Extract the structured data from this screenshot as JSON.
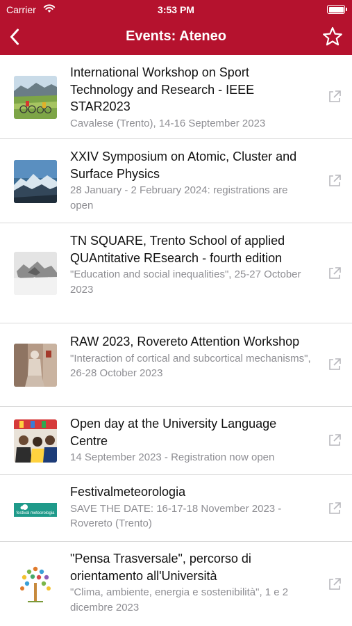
{
  "status": {
    "carrier": "Carrier",
    "time": "3:53 PM"
  },
  "nav": {
    "title": "Events: Ateneo",
    "back_icon": "chevron-left-icon",
    "favorite_icon": "star-icon"
  },
  "colors": {
    "brand": "#b5122e",
    "subtitle": "#8e8e93",
    "separator": "#d9d9d9",
    "external_icon": "#b8b8bd"
  },
  "events": [
    {
      "title": "International Workshop on Sport Technology and Research - IEEE STAR2023",
      "subtitle": "Cavalese (Trento), 14-16 September 2023",
      "image": "cyclists-in-mountains"
    },
    {
      "title": "XXIV Symposium on Atomic, Cluster and Surface Physics",
      "subtitle": "28 January - 2 February 2024: registrations are open",
      "image": "snowy-mountains"
    },
    {
      "title": "TN SQUARE, Trento School of applied QUAntitative REsearch - fourth edition",
      "subtitle": "\"Education and social inequalities\", 25-27 October 2023",
      "image": "misty-peaks"
    },
    {
      "title": "RAW 2023, Rovereto Attention Workshop",
      "subtitle": "\"Interaction of cortical and subcortical mechanisms\", 26-28 October 2023",
      "image": "statue"
    },
    {
      "title": "Open day at the University Language Centre",
      "subtitle": "14 September 2023 - Registration now open",
      "image": "students-crowd"
    },
    {
      "title": "Festivalmeteorologia",
      "subtitle": "SAVE THE DATE: 16-17-18 November 2023 - Rovereto (Trento)",
      "image": "festival-logo",
      "logo_text": "festival meteorologia"
    },
    {
      "title": "\"Pensa Trasversale\", percorso di orientamento all'Università",
      "subtitle": "\"Clima, ambiente, energia e sostenibilità\", 1 e 2 dicembre 2023",
      "image": "tree-logo"
    }
  ]
}
